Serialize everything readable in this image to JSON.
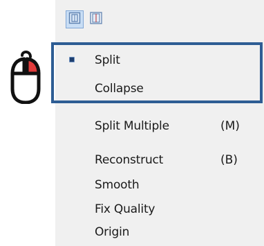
{
  "toolbar": {
    "buttons": [
      {
        "icon": "split-view-icon",
        "active": true
      },
      {
        "icon": "book-view-icon",
        "active": false
      }
    ]
  },
  "indicator": {
    "icon": "mouse-right-click-icon"
  },
  "menu": {
    "items": [
      {
        "label": "Split",
        "shortcut": "",
        "selected": true
      },
      {
        "label": "Collapse",
        "shortcut": ""
      },
      {
        "label": "Split Multiple",
        "shortcut": "(M)"
      },
      {
        "label": "Reconstruct",
        "shortcut": "(B)"
      },
      {
        "label": "Smooth",
        "shortcut": ""
      },
      {
        "label": "Fix Quality",
        "shortcut": ""
      },
      {
        "label": "Origin",
        "shortcut": ""
      }
    ]
  },
  "colors": {
    "panel_bg": "#f0f0f0",
    "highlight_border": "#2e5d94",
    "mouse_button_red": "#e23b3b"
  }
}
